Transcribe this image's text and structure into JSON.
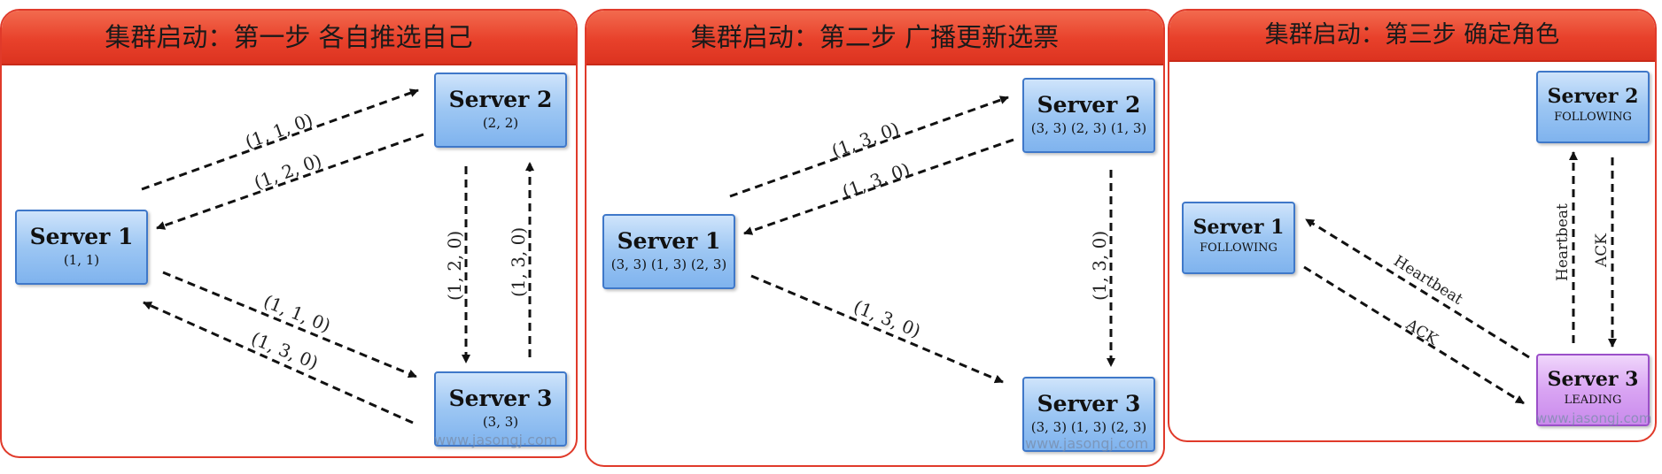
{
  "panels": [
    {
      "title": "集群启动：第一步 各自推选自己",
      "servers": {
        "s1": {
          "name": "Server 1",
          "vote": "(1, 1)"
        },
        "s2": {
          "name": "Server 2",
          "vote": "(2, 2)"
        },
        "s3": {
          "name": "Server 3",
          "vote": "(3, 3)"
        }
      },
      "edge_labels": {
        "s1_to_s2": "(1, 1, 0)",
        "s2_to_s1": "(1, 2, 0)",
        "s2_to_s3": "(1, 2, 0)",
        "s3_to_s2": "(1, 3, 0)",
        "s1_to_s3": "(1, 1, 0)",
        "s3_to_s1": "(1, 3, 0)"
      },
      "watermark": "www.jasongj.com"
    },
    {
      "title": "集群启动：第二步 广播更新选票",
      "servers": {
        "s1": {
          "name": "Server 1",
          "vote": "(3, 3) (1, 3) (2, 3)"
        },
        "s2": {
          "name": "Server 2",
          "vote": "(3, 3) (2, 3) (1, 3)"
        },
        "s3": {
          "name": "Server 3",
          "vote": "(3, 3) (1, 3) (2, 3)"
        }
      },
      "edge_labels": {
        "s1_to_s2": "(1, 3, 0)",
        "s2_to_s1": "(1, 3, 0)",
        "s2_to_s3": "(1, 3, 0)",
        "s1_to_s3": "(1, 3, 0)"
      },
      "watermark": "www.jasongj.com"
    },
    {
      "title": "集群启动：第三步 确定角色",
      "servers": {
        "s1": {
          "name": "Server 1",
          "role": "FOLLOWING"
        },
        "s2": {
          "name": "Server 2",
          "role": "FOLLOWING"
        },
        "s3": {
          "name": "Server 3",
          "role": "LEADING"
        }
      },
      "edge_labels": {
        "s3_to_s1": "Heartbeat",
        "s1_to_s3": "ACK",
        "s3_to_s2": "Heartbeat",
        "s2_to_s3": "ACK"
      },
      "watermark": "www.jasongj.com"
    }
  ],
  "colors": {
    "header_red": "#e8412b",
    "border_red": "#e03a2a",
    "server_blue": "#9cc6f3",
    "leader_purple": "#d9a4f3",
    "arrow": "#111111"
  }
}
